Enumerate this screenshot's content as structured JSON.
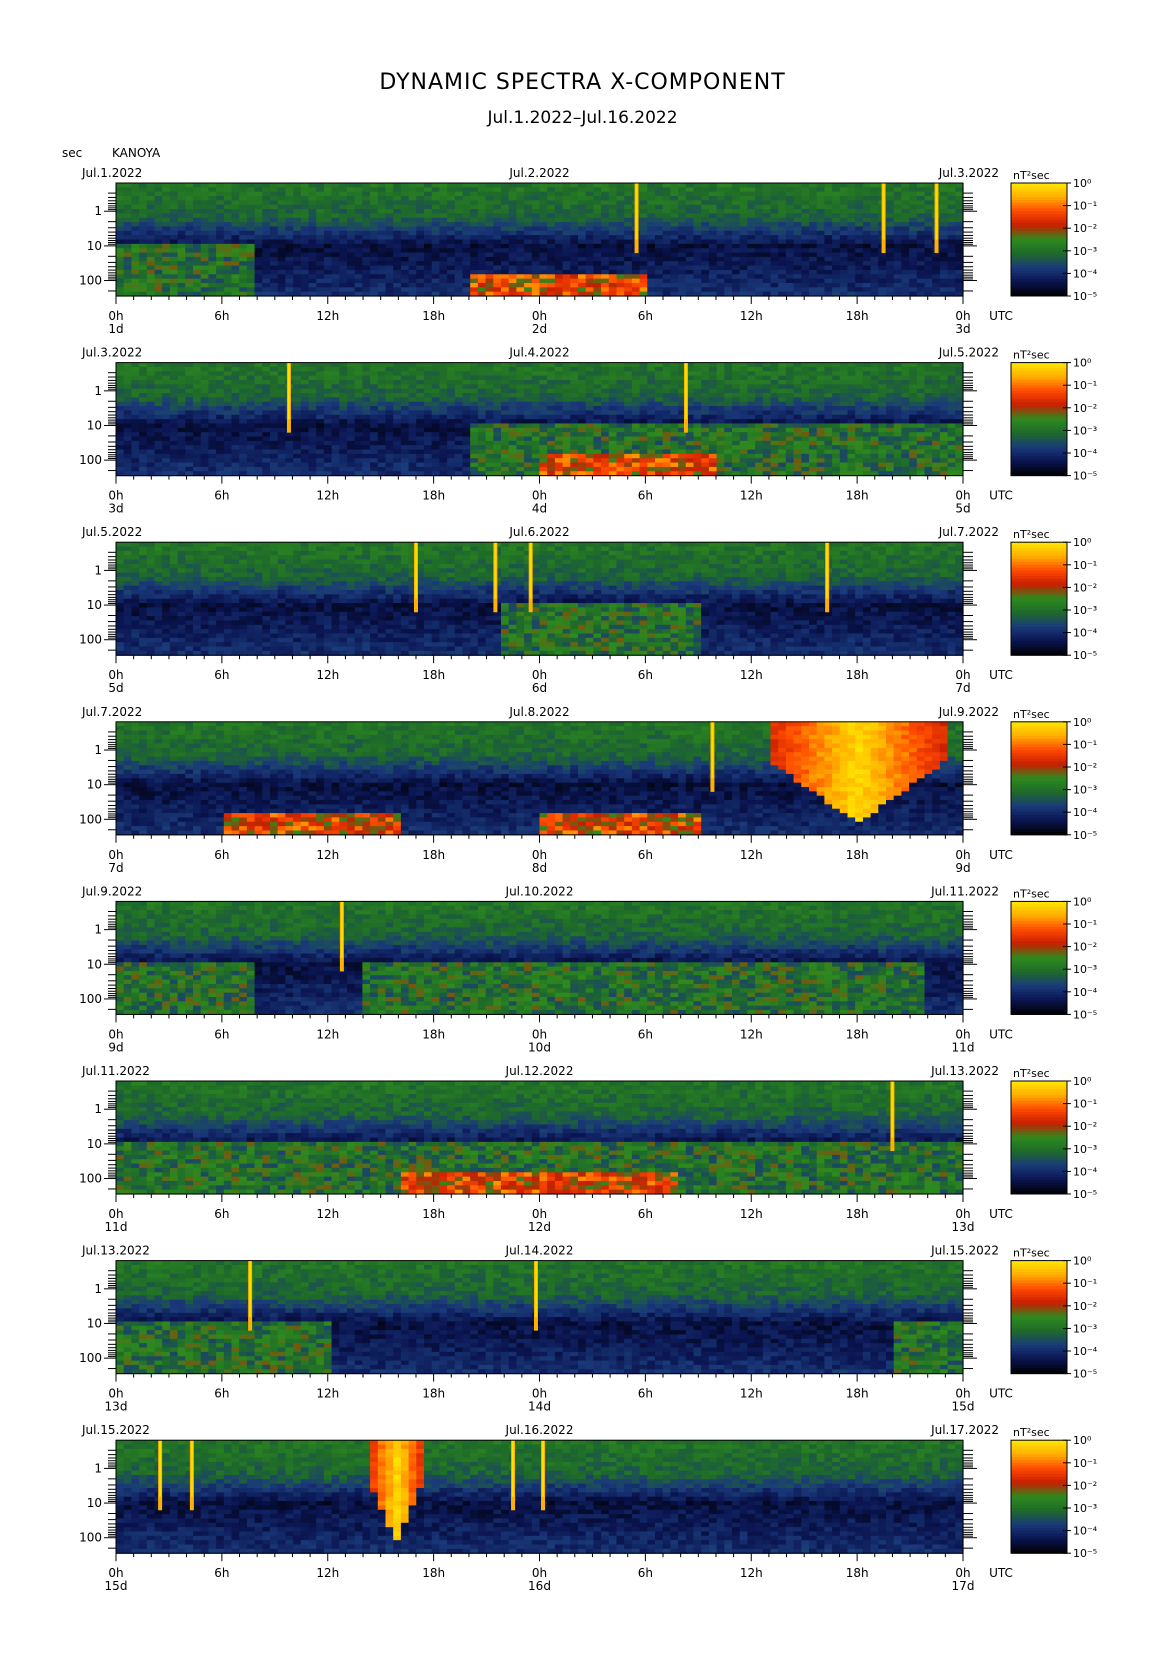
{
  "header": {
    "title": "DYNAMIC SPECTRA X-COMPONENT",
    "subtitle": "Jul.1.2022–Jul.16.2022",
    "unit": "sec",
    "station": "KANOYA"
  },
  "colors": {
    "spectrum": [
      "#000000",
      "#0a1450",
      "#1a3a7a",
      "#1e6a2a",
      "#2e8a1e",
      "#c81e00",
      "#ff4a00",
      "#ffae00",
      "#ffe800"
    ]
  },
  "chart_data": {
    "type": "heatmap",
    "title": "DYNAMIC SPECTRA X-COMPONENT",
    "subtitle": "Jul.1.2022–Jul.16.2022",
    "ylabel": "sec",
    "yscale": "log",
    "y_ticks": [
      "1",
      "10",
      "100"
    ],
    "x_ticks": [
      "0h",
      "6h",
      "12h",
      "18h",
      "0h",
      "6h",
      "12h",
      "18h",
      "0h"
    ],
    "x_unit": "UTC",
    "colorbar_label": "nT²sec",
    "colorbar_ticks": [
      "10⁰",
      "10⁻¹",
      "10⁻²",
      "10⁻³",
      "10⁻⁴",
      "10⁻⁵"
    ],
    "panels": [
      {
        "start": "Jul.1.2022",
        "mid": "Jul.2.2022",
        "end": "Jul.3.2022",
        "day_start": "1d",
        "day_mid": "2d",
        "day_end": "3d",
        "features": [
          {
            "type": "spike",
            "hour": 29.5
          },
          {
            "type": "spike",
            "hour": 43.5
          },
          {
            "type": "spike",
            "hour": 46.5
          },
          {
            "type": "low_red_band",
            "start_hour": 20,
            "end_hour": 30
          },
          {
            "type": "green_activity",
            "start_hour": 0,
            "end_hour": 8
          }
        ]
      },
      {
        "start": "Jul.3.2022",
        "mid": "Jul.4.2022",
        "end": "Jul.5.2022",
        "day_start": "3d",
        "day_mid": "4d",
        "day_end": "5d",
        "features": [
          {
            "type": "spike",
            "hour": 9.8
          },
          {
            "type": "spike",
            "hour": 32.3
          },
          {
            "type": "low_red_band",
            "start_hour": 24,
            "end_hour": 34
          },
          {
            "type": "green_activity",
            "start_hour": 20,
            "end_hour": 48
          }
        ]
      },
      {
        "start": "Jul.5.2022",
        "mid": "Jul.6.2022",
        "end": "Jul.7.2022",
        "day_start": "5d",
        "day_mid": "6d",
        "day_end": "7d",
        "features": [
          {
            "type": "spike",
            "hour": 17
          },
          {
            "type": "spike",
            "hour": 21.5
          },
          {
            "type": "spike",
            "hour": 23.5
          },
          {
            "type": "spike",
            "hour": 40.3
          },
          {
            "type": "green_activity",
            "start_hour": 22,
            "end_hour": 33
          }
        ]
      },
      {
        "start": "Jul.7.2022",
        "mid": "Jul.8.2022",
        "end": "Jul.9.2022",
        "day_start": "7d",
        "day_mid": "8d",
        "day_end": "9d",
        "features": [
          {
            "type": "spike",
            "hour": 33.8
          },
          {
            "type": "storm",
            "start_hour": 37,
            "end_hour": 47
          },
          {
            "type": "low_red_band",
            "start_hour": 6,
            "end_hour": 16
          },
          {
            "type": "low_red_band",
            "start_hour": 24,
            "end_hour": 33
          }
        ]
      },
      {
        "start": "Jul.9.2022",
        "mid": "Jul.10.2022",
        "end": "Jul.11.2022",
        "day_start": "9d",
        "day_mid": "10d",
        "day_end": "11d",
        "features": [
          {
            "type": "spike",
            "hour": 12.8
          },
          {
            "type": "green_activity",
            "start_hour": 0,
            "end_hour": 8
          },
          {
            "type": "green_activity",
            "start_hour": 14,
            "end_hour": 46
          }
        ]
      },
      {
        "start": "Jul.11.2022",
        "mid": "Jul.12.2022",
        "end": "Jul.13.2022",
        "day_start": "11d",
        "day_mid": "12d",
        "day_end": "13d",
        "features": [
          {
            "type": "spike",
            "hour": 44
          },
          {
            "type": "green_activity",
            "start_hour": 0,
            "end_hour": 48
          },
          {
            "type": "low_red_band",
            "start_hour": 16,
            "end_hour": 32
          }
        ]
      },
      {
        "start": "Jul.13.2022",
        "mid": "Jul.14.2022",
        "end": "Jul.15.2022",
        "day_start": "13d",
        "day_mid": "14d",
        "day_end": "15d",
        "features": [
          {
            "type": "spike",
            "hour": 7.6
          },
          {
            "type": "spike",
            "hour": 23.8
          },
          {
            "type": "green_activity",
            "start_hour": 0,
            "end_hour": 12
          },
          {
            "type": "green_activity",
            "start_hour": 44,
            "end_hour": 48
          }
        ]
      },
      {
        "start": "Jul.15.2022",
        "mid": "Jul.16.2022",
        "end": "Jul.17.2022",
        "day_start": "15d",
        "day_mid": "16d",
        "day_end": "17d",
        "features": [
          {
            "type": "spike",
            "hour": 2.5
          },
          {
            "type": "spike",
            "hour": 4.3
          },
          {
            "type": "storm",
            "start_hour": 14.3,
            "end_hour": 17.5
          },
          {
            "type": "spike",
            "hour": 22.5
          },
          {
            "type": "spike",
            "hour": 24.2
          }
        ]
      }
    ]
  }
}
